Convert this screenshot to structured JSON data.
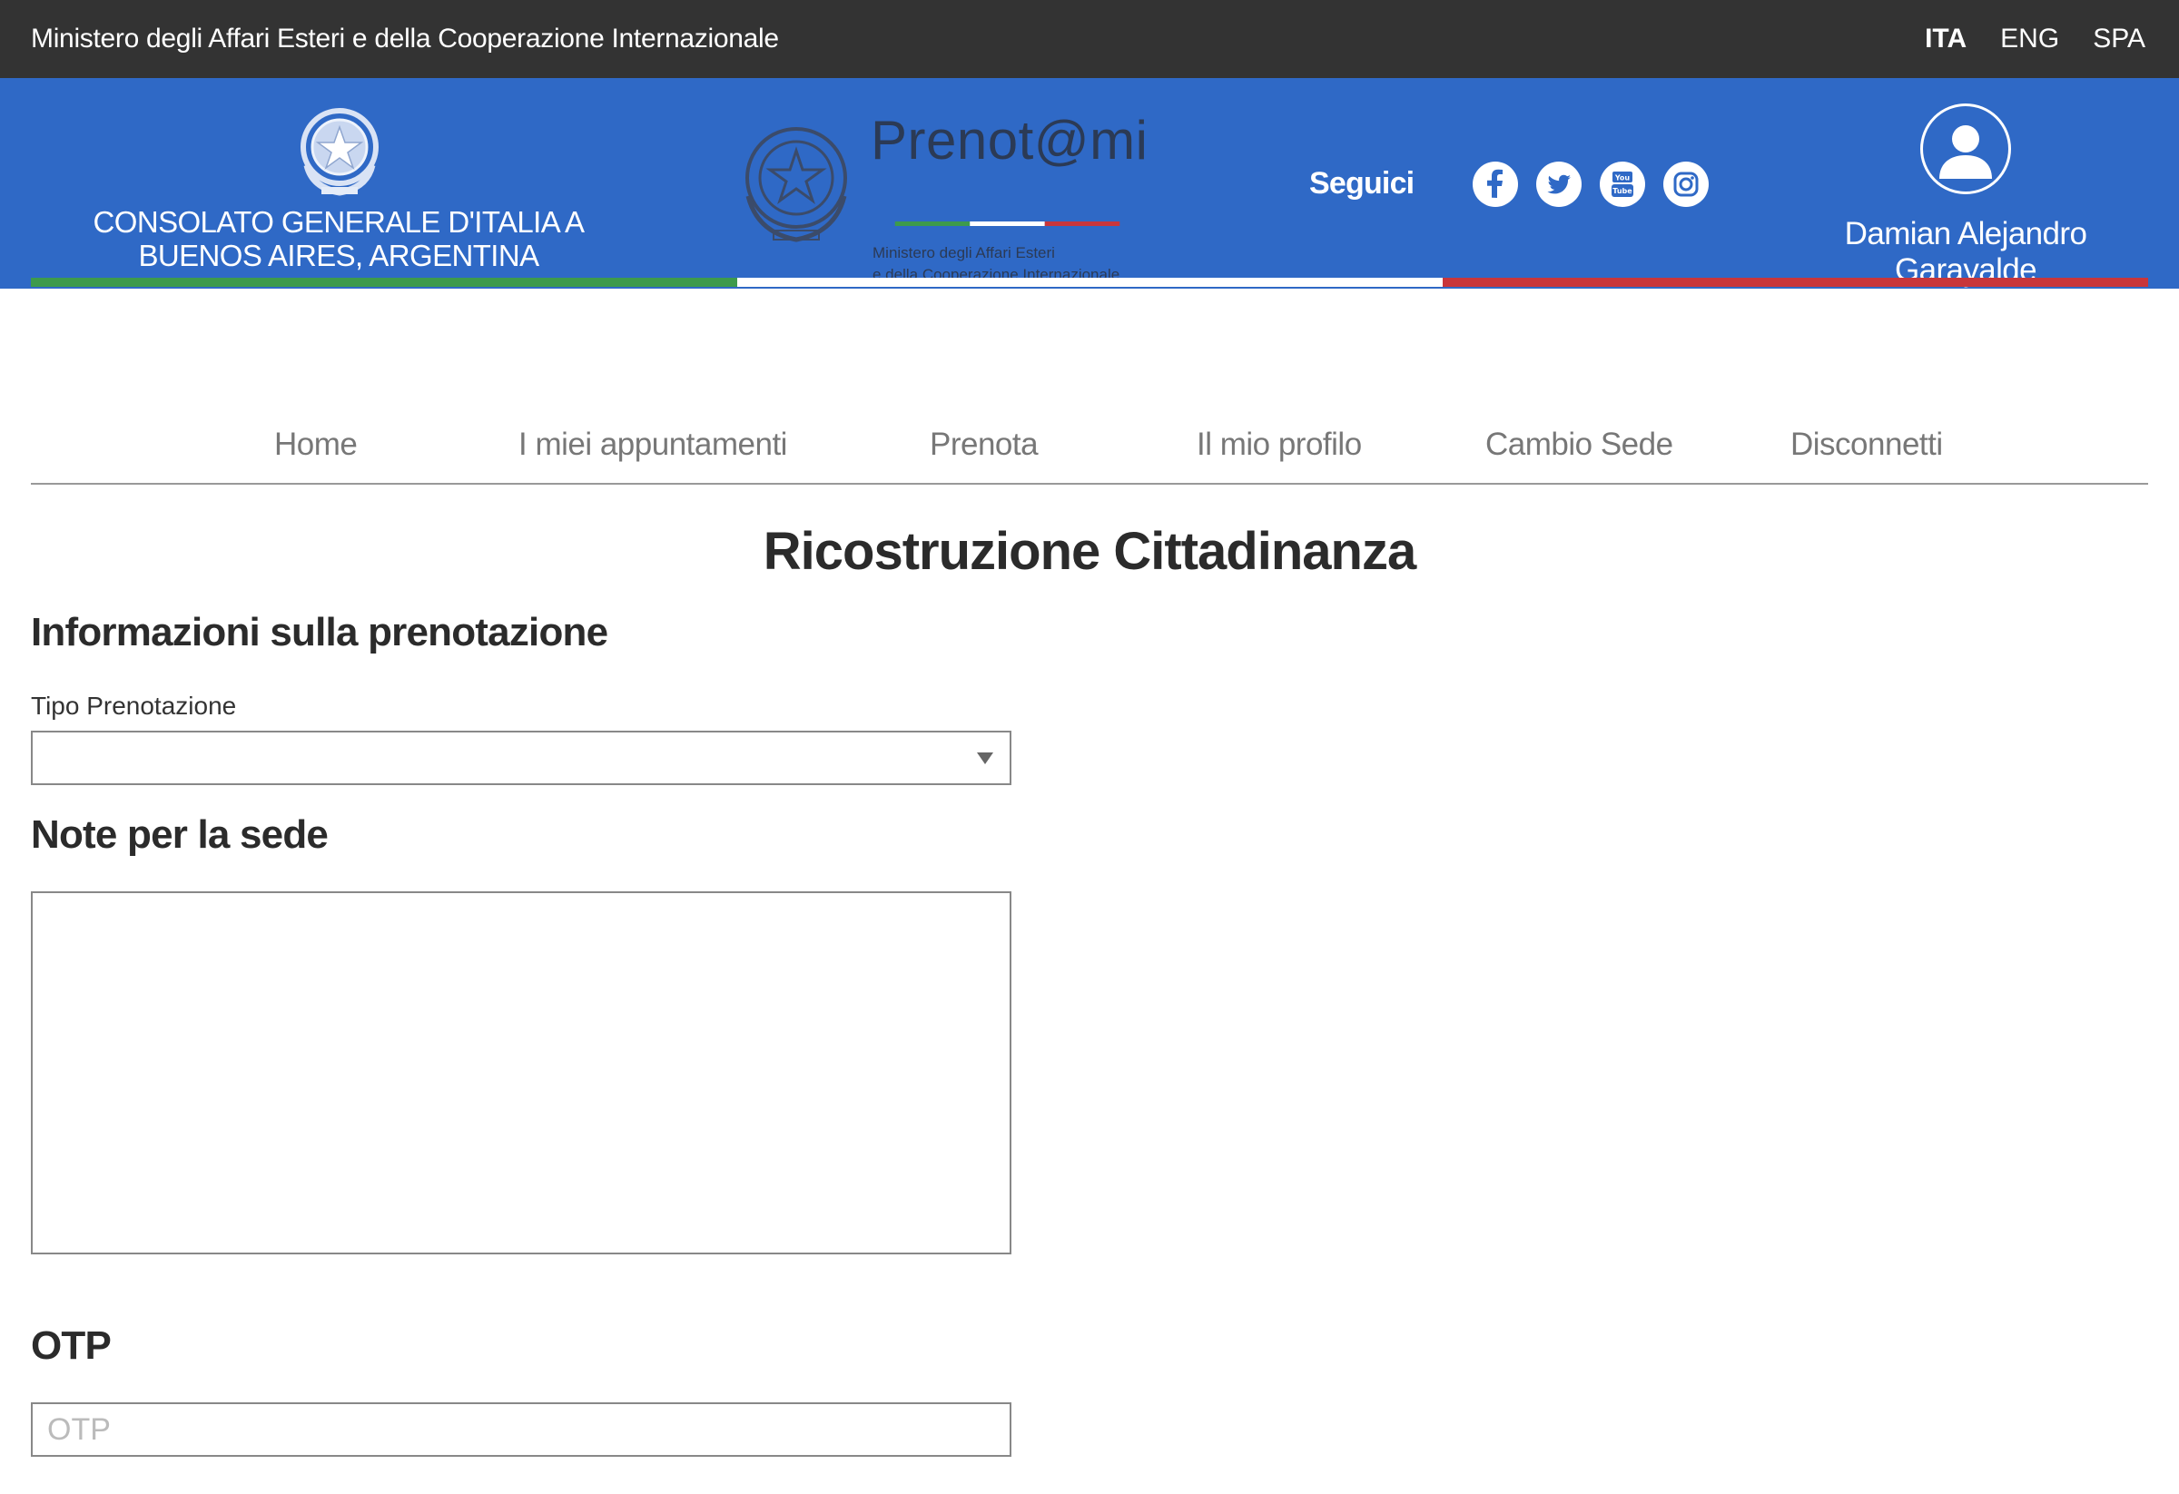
{
  "topbar": {
    "ministry": "Ministero degli Affari Esteri e della Cooperazione Internazionale",
    "languages": [
      {
        "label": "ITA",
        "active": true
      },
      {
        "label": "ENG",
        "active": false
      },
      {
        "label": "SPA",
        "active": false
      }
    ]
  },
  "header": {
    "consolato_line1": "CONSOLATO GENERALE D'ITALIA A",
    "consolato_line2": "BUENOS AIRES, ARGENTINA",
    "brand": "Prenot@mi",
    "brand_sub_line1": "Ministero degli Affari Esteri",
    "brand_sub_line2": "e della Cooperazione Internazionale",
    "seguici": "Seguici",
    "social_icons": [
      "facebook-icon",
      "twitter-icon",
      "youtube-icon",
      "instagram-icon"
    ],
    "user_name": "Damian Alejandro Garayalde",
    "colors": {
      "header_bg": "#2f69c6",
      "topbar_bg": "#333333",
      "flag_green": "#3d9a4c",
      "flag_white": "#ffffff",
      "flag_red": "#c8363b"
    }
  },
  "nav": {
    "items": [
      "Home",
      "I miei appuntamenti",
      "Prenota",
      "Il mio profilo",
      "Cambio Sede",
      "Disconnetti"
    ]
  },
  "main": {
    "title": "Ricostruzione Cittadinanza",
    "section_info": "Informazioni sulla prenotazione",
    "tipo_label": "Tipo Prenotazione",
    "tipo_value": "",
    "section_note": "Note per la sede",
    "note_value": "",
    "section_otp": "OTP",
    "otp_placeholder": "OTP",
    "otp_value": ""
  }
}
